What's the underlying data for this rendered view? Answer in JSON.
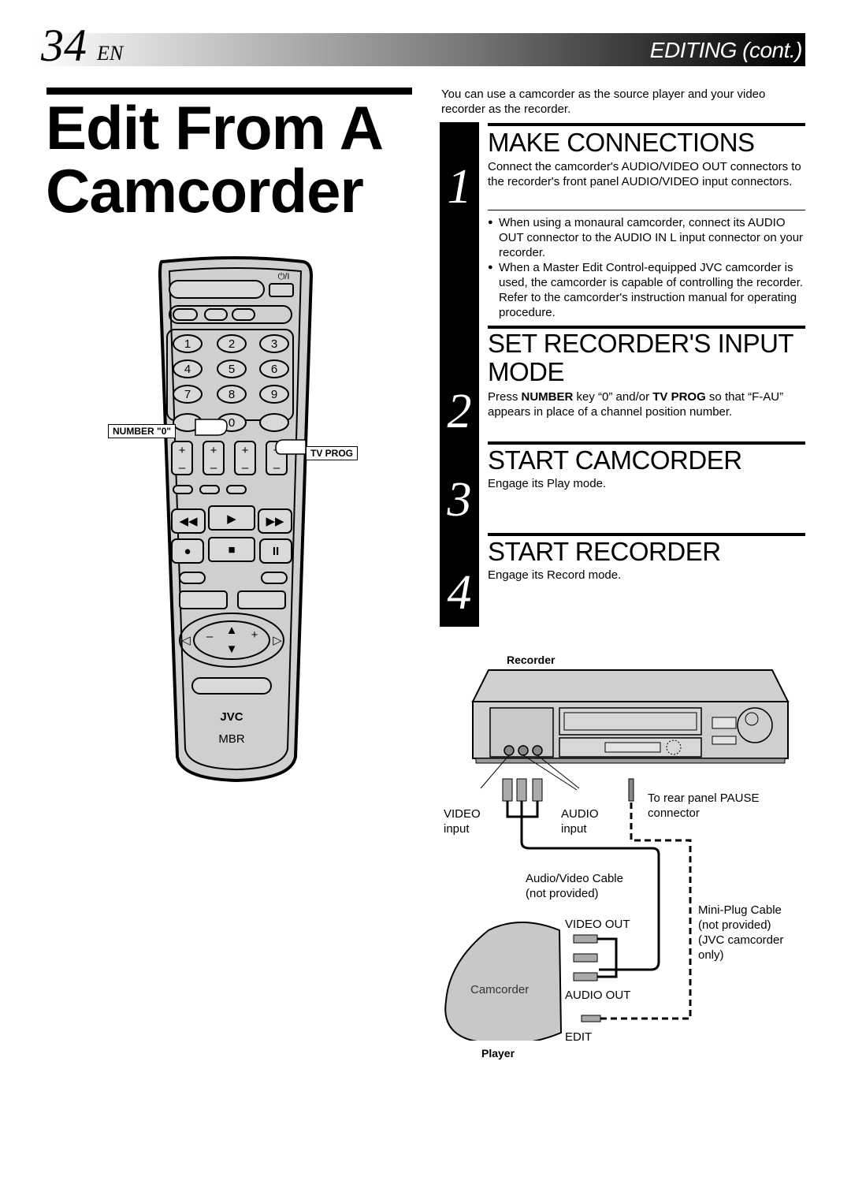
{
  "header": {
    "page_number": "34",
    "language": "EN",
    "section": "EDITING (cont.)"
  },
  "title": {
    "line1": "Edit From A",
    "line2": "Camcorder"
  },
  "intro": "You can use a camcorder as the source player and your video recorder as the recorder.",
  "steps": [
    {
      "number": "1",
      "heading": "MAKE CONNECTIONS",
      "text": "Connect the camcorder's AUDIO/VIDEO OUT connectors to the recorder's front panel AUDIO/VIDEO input connectors.",
      "notes": [
        "When using a monaural camcorder, connect its AUDIO OUT connector to the AUDIO IN L input connector on your recorder.",
        "When a Master Edit Control-equipped JVC camcorder is used, the camcorder is capable of controlling the recorder. Refer to the camcorder's instruction manual for operating procedure."
      ]
    },
    {
      "number": "2",
      "heading_line1": "SET RECORDER'S INPUT",
      "heading_line2": "MODE",
      "text_parts": {
        "press": "Press ",
        "number_key": "NUMBER",
        "mid": " key “0” and/or ",
        "tv_prog": "TV PROG",
        "end": " so that “F-AU” appears in place of a channel position number."
      }
    },
    {
      "number": "3",
      "heading": "START CAMCORDER",
      "text": "Engage its Play mode."
    },
    {
      "number": "4",
      "heading": "START RECORDER",
      "text": "Engage its Record mode."
    }
  ],
  "remote": {
    "brand": "JVC",
    "sub_brand": "MBR",
    "power_label": "⏻/I",
    "number_keys": [
      "1",
      "2",
      "3",
      "4",
      "5",
      "6",
      "7",
      "8",
      "9",
      "0"
    ],
    "callout_number": "NUMBER \"0\"",
    "callout_tvprog": "TV PROG",
    "plus": "+",
    "minus": "–",
    "play": "▶",
    "stop": "■",
    "pause": "II",
    "record": "●",
    "rewind": "◀◀",
    "ffwd": "▶▶",
    "badge_2": "2",
    "badge_4": "4",
    "badge_1": "1",
    "badge_3": "3"
  },
  "diagram": {
    "recorder_label": "Recorder",
    "player_label": "Player",
    "video_input": [
      "VIDEO",
      "input"
    ],
    "audio_input": [
      "AUDIO",
      "input"
    ],
    "pause_connector": [
      "To rear panel PAUSE",
      "connector"
    ],
    "av_cable": [
      "Audio/Video Cable",
      "(not provided)"
    ],
    "miniplug_cable": [
      "Mini-Plug Cable",
      "(not provided)",
      "(JVC camcorder",
      "only)"
    ],
    "video_out": "VIDEO OUT",
    "audio_out": "AUDIO OUT",
    "edit": "EDIT",
    "camcorder": "Camcorder"
  }
}
